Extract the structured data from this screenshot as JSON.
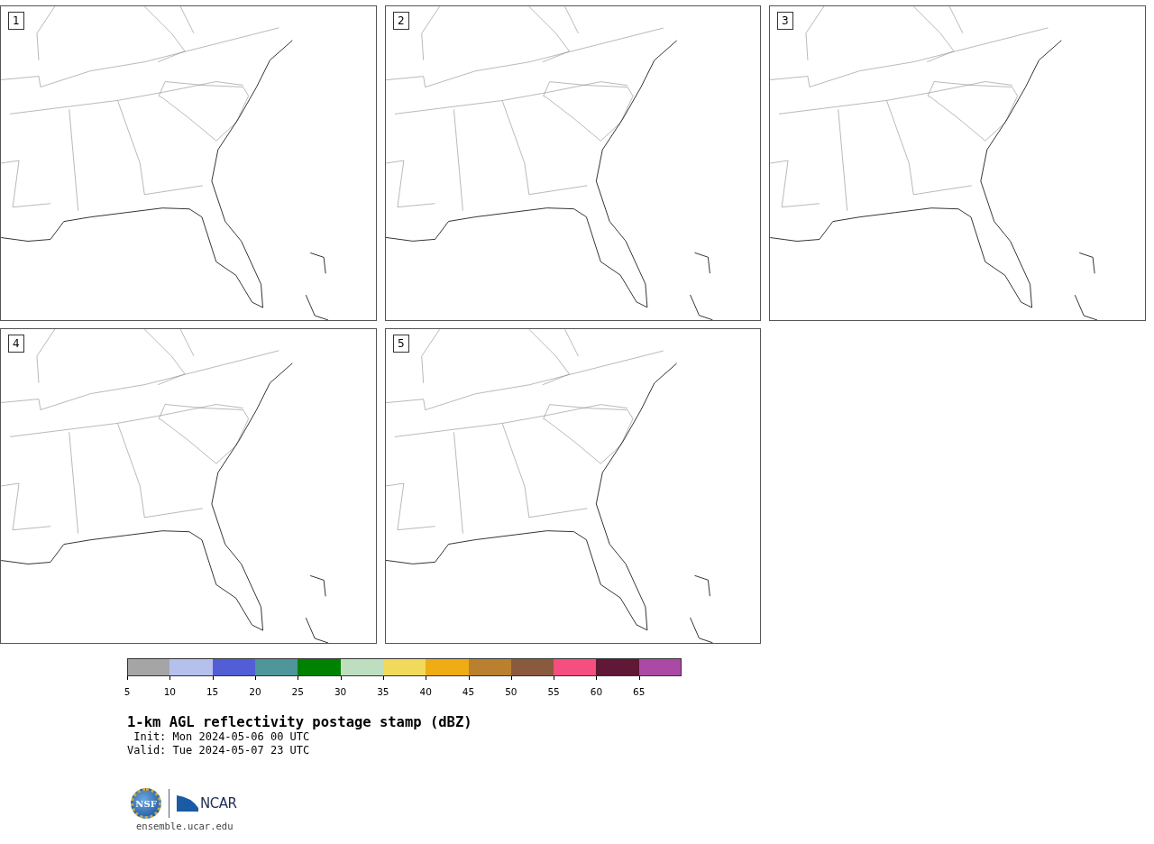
{
  "panels": [
    {
      "label": "1"
    },
    {
      "label": "2"
    },
    {
      "label": "3"
    },
    {
      "label": "4"
    },
    {
      "label": "5"
    }
  ],
  "colorbar": {
    "segments": [
      {
        "color": "#a5a5a5"
      },
      {
        "color": "#b5c0ec"
      },
      {
        "color": "#525ed6"
      },
      {
        "color": "#4e9699"
      },
      {
        "color": "#008200"
      },
      {
        "color": "#bedfbf"
      },
      {
        "color": "#f0d95b"
      },
      {
        "color": "#f0ac15"
      },
      {
        "color": "#b9802f"
      },
      {
        "color": "#8a5a3f"
      },
      {
        "color": "#f44f7e"
      },
      {
        "color": "#5f1836"
      },
      {
        "color": "#ab4aa5"
      }
    ],
    "ticks": [
      "5",
      "10",
      "15",
      "20",
      "25",
      "30",
      "35",
      "40",
      "45",
      "50",
      "55",
      "60",
      "65"
    ]
  },
  "title": "1-km AGL reflectivity postage stamp (dBZ)",
  "init": " Init: Mon 2024-05-06 00 UTC",
  "valid": "Valid: Tue 2024-05-07 23 UTC",
  "logos": {
    "left": "NSF",
    "right": "NCAR"
  },
  "footer": "ensemble.ucar.edu"
}
